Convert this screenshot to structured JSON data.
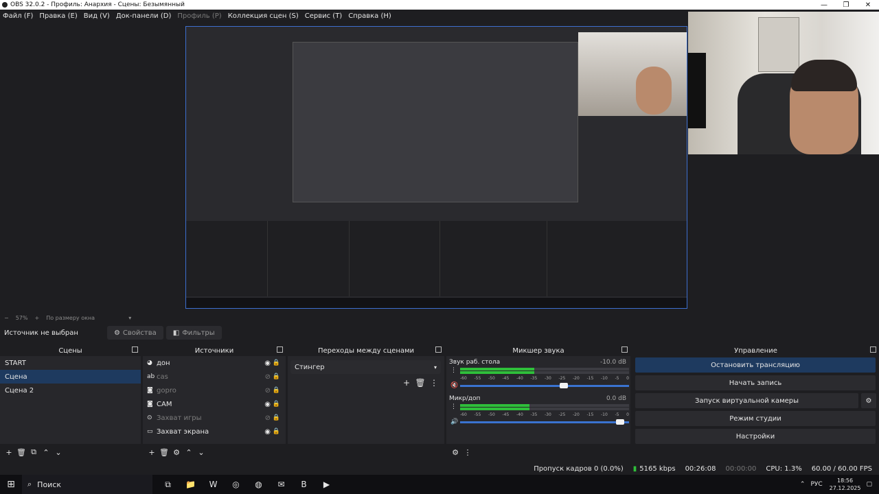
{
  "window": {
    "title": "OBS 32.0.2 - Профиль: Анархия - Сцены: Безымянный",
    "minimize": "—",
    "restore": "❐",
    "close": "✕"
  },
  "menu": {
    "items": [
      {
        "label": "Файл (F)",
        "disabled": false
      },
      {
        "label": "Правка (E)",
        "disabled": false
      },
      {
        "label": "Вид (V)",
        "disabled": false
      },
      {
        "label": "Док-панели (D)",
        "disabled": false
      },
      {
        "label": "Профиль (P)",
        "disabled": true
      },
      {
        "label": "Коллекция сцен (S)",
        "disabled": false
      },
      {
        "label": "Сервис (T)",
        "disabled": false
      },
      {
        "label": "Справка (H)",
        "disabled": false
      }
    ]
  },
  "zoom": {
    "minus": "−",
    "value": "57%",
    "plus": "+",
    "mode": "По размеру окна",
    "dropdown": "▾"
  },
  "source_bar": {
    "label": "Источник не выбран",
    "properties": "Свойства",
    "filters": "Фильтры",
    "gear_icon": "⚙",
    "filter_icon": "◧"
  },
  "docks": {
    "scenes": {
      "title": "Сцены",
      "items": [
        {
          "label": "START",
          "selected": false
        },
        {
          "label": "Сцена",
          "selected": true
        },
        {
          "label": "Сцена 2",
          "selected": false
        }
      ],
      "footer": [
        "+",
        "🗑",
        "⧉",
        "⌃",
        "⌄"
      ]
    },
    "sources": {
      "title": "Источники",
      "items": [
        {
          "icon": "◕",
          "label": "дон",
          "visible": true,
          "dim": false
        },
        {
          "icon": "ab",
          "label": "cas",
          "visible": false,
          "dim": true
        },
        {
          "icon": "◙",
          "label": "gopro",
          "visible": false,
          "dim": true
        },
        {
          "icon": "◙",
          "label": "CAM",
          "visible": true,
          "dim": false
        },
        {
          "icon": "⊙",
          "label": "Захват игры",
          "visible": false,
          "dim": true
        },
        {
          "icon": "▭",
          "label": "Захват экрана",
          "visible": true,
          "dim": false
        }
      ],
      "eye_on": "◉",
      "eye_off": "⊘",
      "lock": "🔒",
      "footer": [
        "+",
        "🗑",
        "⚙",
        "⌃",
        "⌄"
      ]
    },
    "transitions": {
      "title": "Переходы между сценами",
      "selected": "Стингер",
      "dd": "▾",
      "add": "+",
      "del": "🗑",
      "more": "⋮"
    },
    "mixer": {
      "title": "Микшер звука",
      "channels": [
        {
          "name": "Звук раб. стола",
          "db": "-10.0 dB",
          "level": 0.44,
          "volume": 0.64,
          "muted": true
        },
        {
          "name": "Микр/доп",
          "db": "0.0 dB",
          "level": 0.41,
          "volume": 0.97,
          "muted": false
        }
      ],
      "scale": [
        "-60",
        "-55",
        "-50",
        "-45",
        "-40",
        "-35",
        "-30",
        "-25",
        "-20",
        "-15",
        "-10",
        "-5",
        "0"
      ],
      "speaker_icon": "🔊",
      "muted_icon": "🔇",
      "menu_icon": "⋮",
      "footer_gear": "⚙",
      "footer_more": "⋮"
    },
    "controls": {
      "title": "Управление",
      "buttons": [
        {
          "label": "Остановить трансляцию",
          "active": true
        },
        {
          "label": "Начать запись",
          "active": false
        },
        {
          "label": "Запуск виртуальной камеры",
          "active": false
        },
        {
          "label": "Режим студии",
          "active": false
        },
        {
          "label": "Настройки",
          "active": false
        }
      ],
      "gear": "⚙"
    }
  },
  "status": {
    "dropped": "Пропуск кадров 0 (0.0%)",
    "kbps": "5165 kbps",
    "kbps_icon": "▮",
    "stream_time": "00:26:08",
    "rec_time": "00:00:00",
    "cpu": "CPU: 1.3%",
    "fps": "60.00 / 60.00 FPS"
  },
  "taskbar": {
    "start": "⊞",
    "search_placeholder": "Поиск",
    "search_icon": "⌕",
    "apps": [
      "⧉",
      "📁",
      "W",
      "◎",
      "◍",
      "✉",
      "B",
      "▶"
    ],
    "lang": "РУС",
    "time": "18:56",
    "date": "27.12.2025",
    "tray_up": "⌃",
    "notify": "▢"
  }
}
